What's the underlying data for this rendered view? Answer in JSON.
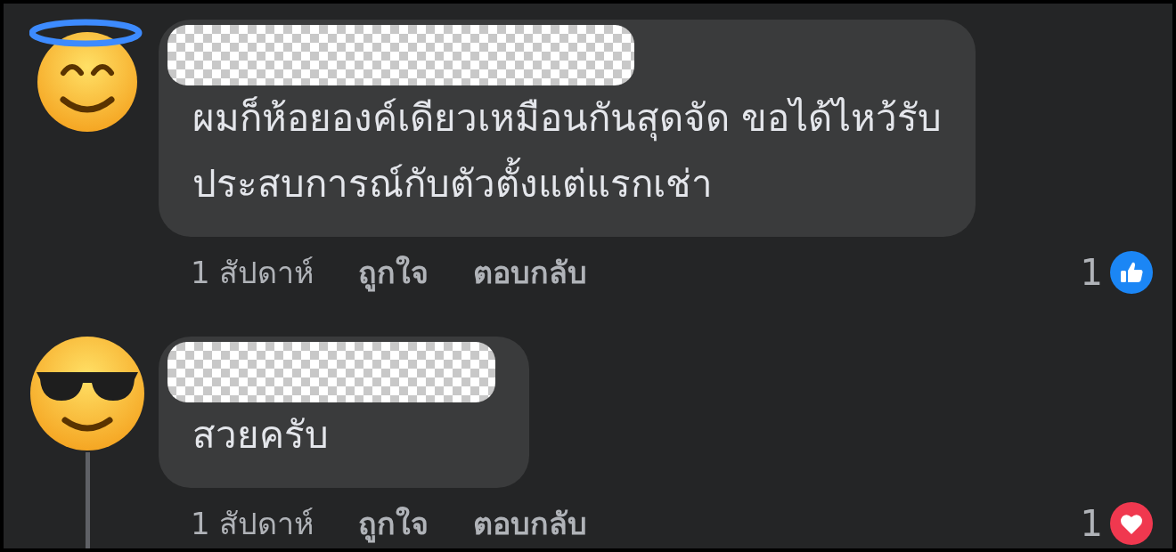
{
  "comments": [
    {
      "avatar": {
        "kind": "halo"
      },
      "name_redacted": true,
      "lines": [
        "ผมก็ห้อยองค์เดียวเหมือนกันสุดจัด ขอได้ไหว้รับ",
        "ประสบการณ์กับตัวตั้งแต่แรกเช่า"
      ],
      "time": "1 สัปดาห์",
      "like_label": "ถูกใจ",
      "reply_label": "ตอบกลับ",
      "reaction": {
        "kind": "like",
        "count": "1"
      },
      "thread_line": false
    },
    {
      "avatar": {
        "kind": "sunglasses"
      },
      "name_redacted": true,
      "lines": [
        "สวยครับ"
      ],
      "time": "1 สัปดาห์",
      "like_label": "ถูกใจ",
      "reply_label": "ตอบกลับ",
      "reaction": {
        "kind": "love",
        "count": "1"
      },
      "thread_line": true
    }
  ]
}
